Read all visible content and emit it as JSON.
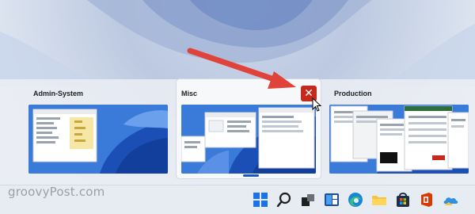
{
  "desktops": [
    {
      "label": "Admin-System"
    },
    {
      "label": "Misc",
      "selected": true
    },
    {
      "label": "Production"
    }
  ],
  "close_button": {
    "glyph": "✕"
  },
  "watermark": {
    "text": "groovyPost.com"
  },
  "taskbar": {
    "icons": [
      "windows-start-icon",
      "search-icon",
      "task-view-icon",
      "widgets-icon",
      "edge-icon",
      "file-explorer-icon",
      "store-icon",
      "office-icon",
      "onedrive-icon"
    ]
  },
  "colors": {
    "close": "#c42b1c",
    "annotation_arrow": "#e0433a",
    "wallpaper_blue": "#2e6fd1"
  }
}
